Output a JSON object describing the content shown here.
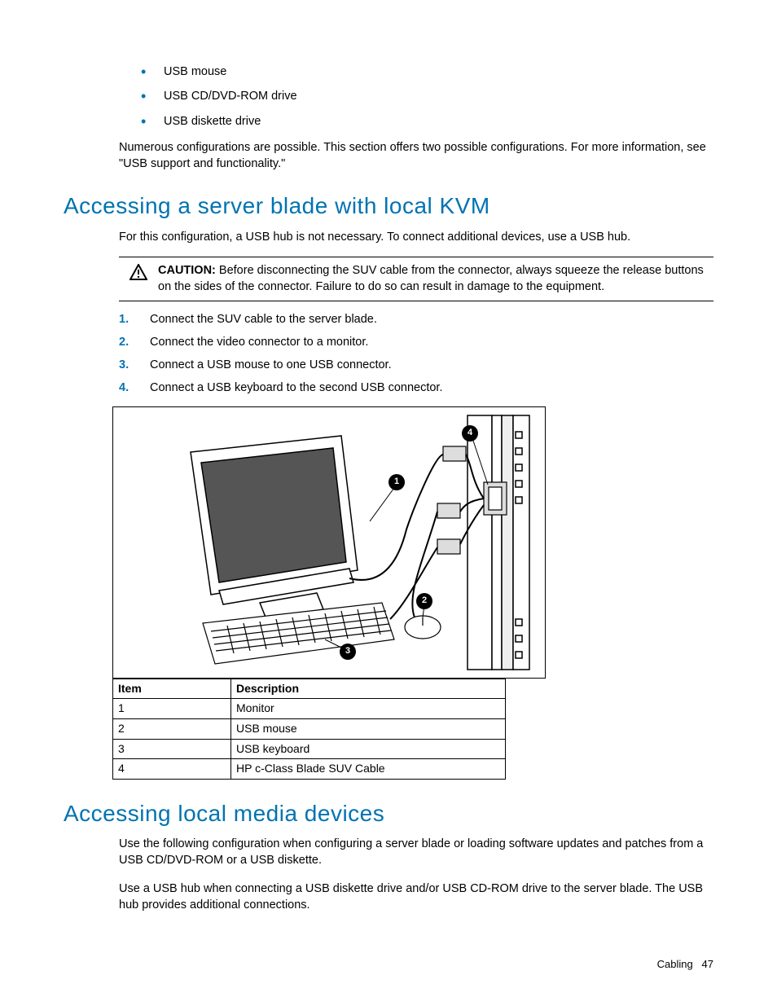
{
  "top_list": {
    "items": [
      "USB mouse",
      "USB CD/DVD-ROM drive",
      "USB diskette drive"
    ]
  },
  "intro_para": "Numerous configurations are possible. This section offers two possible configurations. For more information, see \"USB support and functionality.\"",
  "section1": {
    "heading": "Accessing a server blade with local KVM",
    "intro": "For this configuration, a USB hub is not necessary. To connect additional devices, use a USB hub.",
    "caution_label": "CAUTION:",
    "caution_text": "Before disconnecting the SUV cable from the connector, always squeeze the release buttons on the sides of the connector. Failure to do so can result in damage to the equipment.",
    "steps": [
      "Connect the SUV cable to the server blade.",
      "Connect the video connector to a monitor.",
      "Connect a USB mouse to one USB connector.",
      "Connect a USB keyboard to the second USB connector."
    ],
    "callouts": [
      "1",
      "2",
      "3",
      "4"
    ],
    "table": {
      "headers": {
        "col1": "Item",
        "col2": "Description"
      },
      "rows": [
        {
          "item": "1",
          "desc": "Monitor"
        },
        {
          "item": "2",
          "desc": "USB mouse"
        },
        {
          "item": "3",
          "desc": "USB keyboard"
        },
        {
          "item": "4",
          "desc": "HP c-Class Blade SUV Cable"
        }
      ]
    }
  },
  "section2": {
    "heading": "Accessing local media devices",
    "para1": "Use the following configuration when configuring a server blade or loading software updates and patches from a USB CD/DVD-ROM or a USB diskette.",
    "para2": "Use a USB hub when connecting a USB diskette drive and/or USB CD-ROM drive to the server blade. The USB hub provides additional connections."
  },
  "footer": {
    "section": "Cabling",
    "page": "47"
  }
}
